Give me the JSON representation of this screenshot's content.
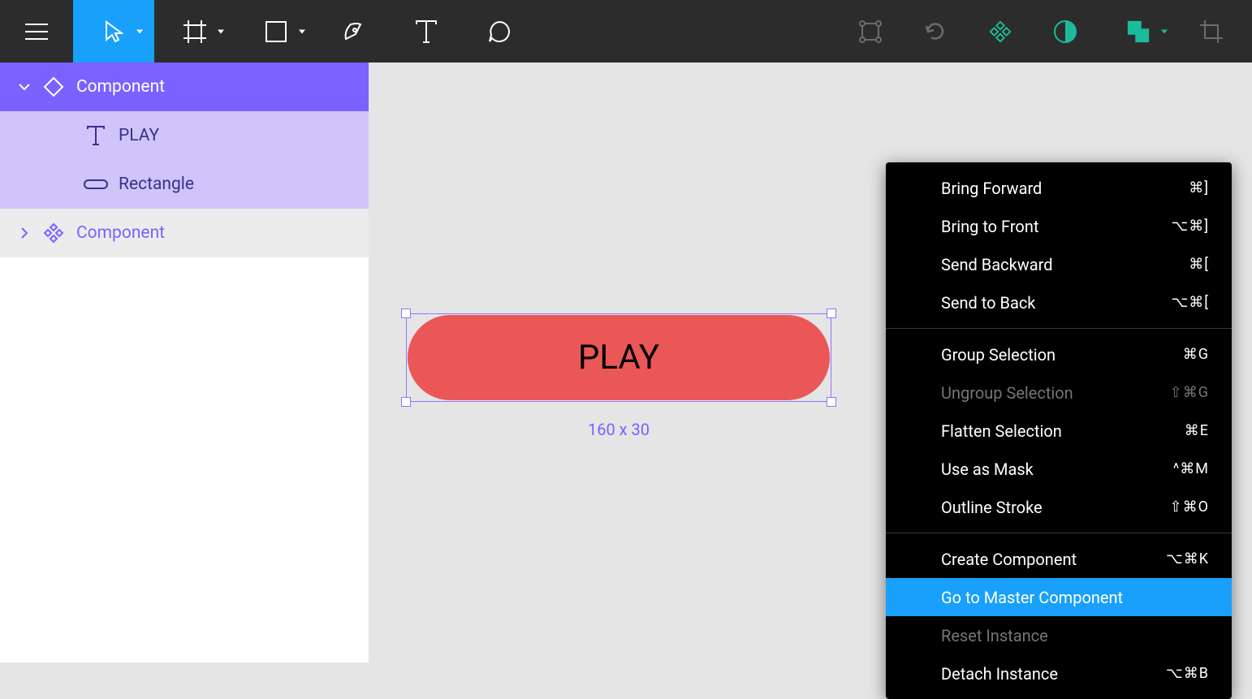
{
  "colors": {
    "toolbar": "#2c2c2c",
    "accent_blue": "#18a0fb",
    "component_purple": "#7b61ff",
    "component_light": "#d0c5fa",
    "accent_green": "#1abc9c",
    "button_red": "#eb5757"
  },
  "layers": {
    "root": {
      "label": "Component"
    },
    "children": [
      {
        "label": "PLAY"
      },
      {
        "label": "Rectangle"
      }
    ],
    "instance": {
      "label": "Component"
    }
  },
  "canvas": {
    "button_text": "PLAY",
    "dimensions": "160 x 30"
  },
  "context_menu": {
    "groups": [
      [
        {
          "label": "Bring Forward",
          "shortcut": "⌘]",
          "disabled": false
        },
        {
          "label": "Bring to Front",
          "shortcut": "⌥⌘]",
          "disabled": false
        },
        {
          "label": "Send Backward",
          "shortcut": "⌘[",
          "disabled": false
        },
        {
          "label": "Send to Back",
          "shortcut": "⌥⌘[",
          "disabled": false
        }
      ],
      [
        {
          "label": "Group Selection",
          "shortcut": "⌘G",
          "disabled": false
        },
        {
          "label": "Ungroup Selection",
          "shortcut": "⇧⌘G",
          "disabled": true
        },
        {
          "label": "Flatten Selection",
          "shortcut": "⌘E",
          "disabled": false
        },
        {
          "label": "Use as Mask",
          "shortcut": "^⌘M",
          "disabled": false
        },
        {
          "label": "Outline Stroke",
          "shortcut": "⇧⌘O",
          "disabled": false
        }
      ],
      [
        {
          "label": "Create Component",
          "shortcut": "⌥⌘K",
          "disabled": false
        },
        {
          "label": "Go to Master Component",
          "shortcut": "",
          "disabled": false,
          "hovered": true
        },
        {
          "label": "Reset Instance",
          "shortcut": "",
          "disabled": true
        },
        {
          "label": "Detach Instance",
          "shortcut": "⌥⌘B",
          "disabled": false
        }
      ]
    ]
  }
}
